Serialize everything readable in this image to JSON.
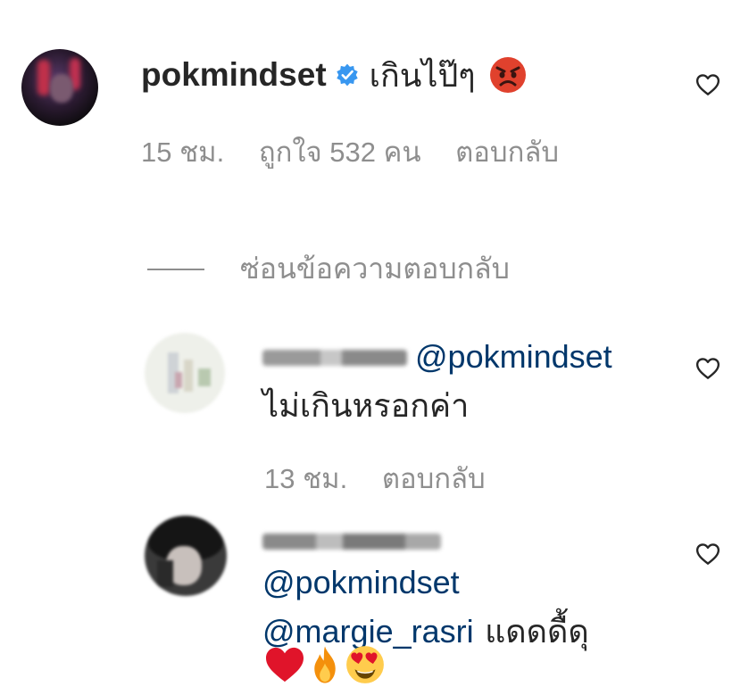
{
  "comment": {
    "username": "pokmindset",
    "text": "เกินไป๊ๆ",
    "emoji": "pouting-face",
    "time": "15 ชม.",
    "likes": "ถูกใจ 532 คน",
    "reply_label": "ตอบกลับ"
  },
  "hide_replies_label": "ซ่อนข้อความตอบกลับ",
  "replies": [
    {
      "mention": "@pokmindset",
      "text": "ไม่เกินหรอกค่า",
      "time": "13 ชม.",
      "reply_label": "ตอบกลับ"
    },
    {
      "mention1": "@pokmindset",
      "mention2": "@margie_rasri",
      "text": "แดดดื้ดุ",
      "emojis": [
        "red-heart",
        "fire",
        "heart-eyes-face"
      ]
    }
  ],
  "colors": {
    "text": "#262626",
    "secondary": "#8e8e8e",
    "mention": "#00376b",
    "verified": "#3897f0",
    "angry_emoji": "#e0412d"
  }
}
